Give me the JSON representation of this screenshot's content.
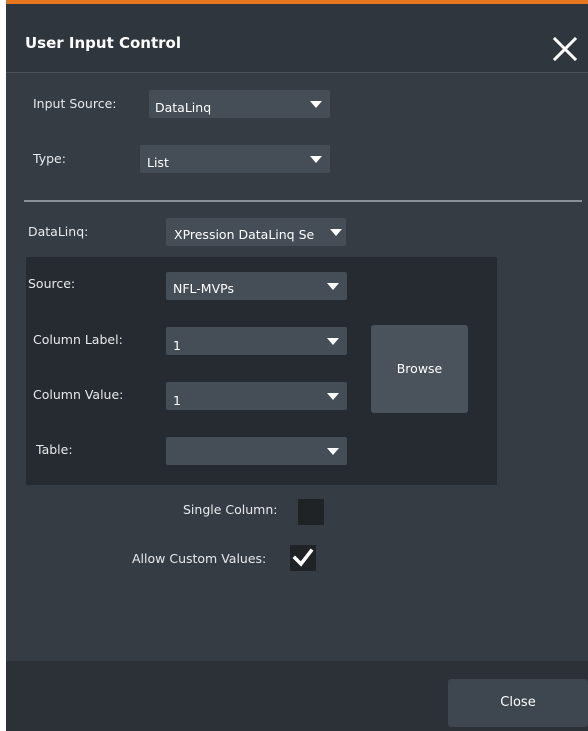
{
  "dialog": {
    "title": "User Input Control",
    "accent_color": "#e8761e",
    "close_icon": "close-icon"
  },
  "form": {
    "input_source": {
      "label": "Input Source:",
      "value": "DataLinq"
    },
    "type": {
      "label": "Type:",
      "value": "List"
    },
    "datalinq": {
      "label": "DataLinq:",
      "value": "XPression DataLinq Se"
    },
    "source": {
      "label": "Source:",
      "value": "NFL-MVPs"
    },
    "column_label": {
      "label": "Column Label:",
      "value": "1"
    },
    "column_value": {
      "label": "Column Value:",
      "value": "1"
    },
    "table": {
      "label": "Table:",
      "value": ""
    },
    "browse_label": "Browse",
    "single_column": {
      "label": "Single Column:",
      "checked": false
    },
    "allow_custom_values": {
      "label": "Allow Custom Values:",
      "checked": true
    }
  },
  "footer": {
    "close_label": "Close"
  }
}
